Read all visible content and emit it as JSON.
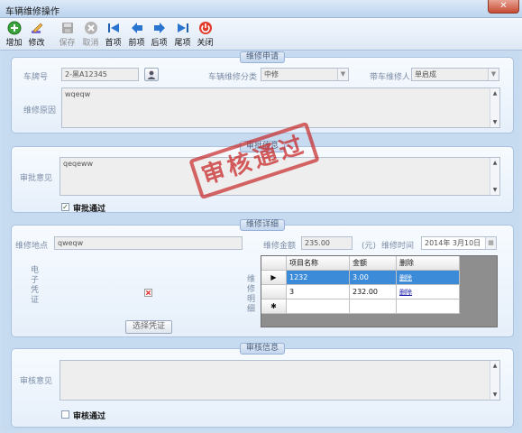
{
  "window": {
    "title": "车辆维修操作",
    "close": "✕"
  },
  "toolbar": [
    {
      "label": "增加",
      "icon": "plus-circle-icon",
      "enabled": true
    },
    {
      "label": "修改",
      "icon": "edit-pencil-icon",
      "enabled": true
    },
    {
      "label": "保存",
      "icon": "save-disk-icon",
      "enabled": false
    },
    {
      "label": "取消",
      "icon": "cancel-icon",
      "enabled": false
    },
    {
      "label": "首项",
      "icon": "first-record-icon",
      "enabled": true
    },
    {
      "label": "前项",
      "icon": "previous-record-icon",
      "enabled": true
    },
    {
      "label": "后项",
      "icon": "next-record-icon",
      "enabled": true
    },
    {
      "label": "尾项",
      "icon": "last-record-icon",
      "enabled": true
    },
    {
      "label": "关闭",
      "icon": "power-close-icon",
      "enabled": true
    }
  ],
  "request": {
    "title": "维修申请",
    "plate_label": "车牌号",
    "plate_value": "2-黑A12345",
    "category_label": "车辆维修分类",
    "category_value": "中修",
    "person_label": "带车维修人",
    "person_value": "单启成",
    "reason_label": "维修原因",
    "reason_value": "wqeqw"
  },
  "approval": {
    "title": "审批信息",
    "opinion_label": "审批意见",
    "opinion_value": "qeqeww",
    "passed_label": "审批通过",
    "passed": true,
    "stamp_text": "审核通过"
  },
  "detail": {
    "title": "维修详细",
    "place_label": "维修地点",
    "place_value": "qweqw",
    "amount_label": "维修金额",
    "amount_value": "235.00",
    "unit": "(元)",
    "time_label": "维修时间",
    "time_value": "2014年 3月10日",
    "voucher_label": "电子凭证",
    "choose_btn": "选择凭证",
    "items_label": "维修明细",
    "columns": [
      "项目名称",
      "金额",
      "删除"
    ],
    "rows": [
      {
        "name": "1232",
        "amount": "3.00",
        "action": "删除"
      },
      {
        "name": "3",
        "amount": "232.00",
        "action": "删除"
      }
    ],
    "new_row_marker": "✱",
    "current_row_marker": "▶"
  },
  "review": {
    "title": "审核信息",
    "opinion_label": "审核意见",
    "passed_label": "审核通过",
    "passed": false
  }
}
